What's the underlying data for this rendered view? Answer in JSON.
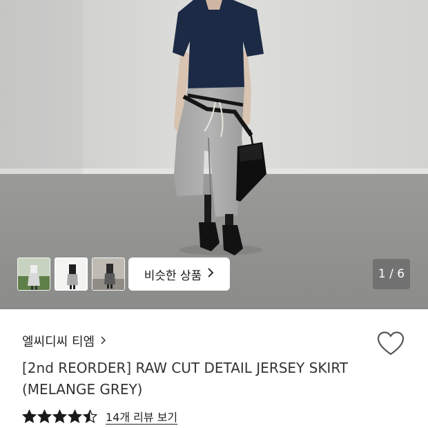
{
  "gallery": {
    "similar_label": "비슷한 상품",
    "counter": "1 / 6",
    "thumbnails": [
      "thumbnail-1",
      "thumbnail-2",
      "thumbnail-3"
    ]
  },
  "product": {
    "brand": "엘씨디씨 티엠",
    "title_line1": "[2nd REORDER] RAW CUT DETAIL JERSEY SKIRT",
    "title_line2": "(MELANGE GREY)",
    "rating": 4.5,
    "review_link": "14개 리뷰 보기"
  },
  "icons": {
    "brand_chevron": "chevron-right-icon",
    "similar_chevron": "chevron-right-icon",
    "wishlist": "heart-outline-icon",
    "star": "star-icon"
  },
  "colors": {
    "star": "#1a1a1a",
    "text": "#222222"
  }
}
